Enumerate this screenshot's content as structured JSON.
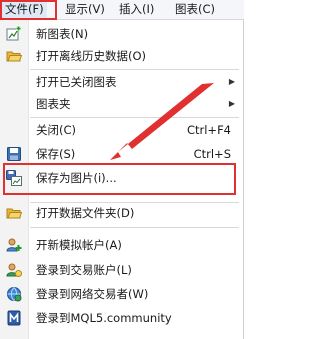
{
  "menubar": {
    "items": [
      {
        "label": "文件(F)"
      },
      {
        "label": "显示(V)"
      },
      {
        "label": "插入(I)"
      },
      {
        "label": "图表(C)"
      }
    ]
  },
  "menu": {
    "items": [
      {
        "label": "新图表(N)",
        "shortcut": "",
        "icon": "new-chart-icon"
      },
      {
        "label": "打开离线历史数据(O)",
        "shortcut": "",
        "icon": "open-folder-icon"
      },
      {
        "label": "打开已关闭图表",
        "shortcut": "",
        "icon": "",
        "submenu": true
      },
      {
        "label": "图表夹",
        "shortcut": "",
        "icon": "",
        "submenu": true
      },
      {
        "label": "关闭(C)",
        "shortcut": "Ctrl+F4",
        "icon": ""
      },
      {
        "label": "保存(S)",
        "shortcut": "Ctrl+S",
        "icon": "save-icon"
      },
      {
        "label": "保存为图片(i)...",
        "shortcut": "",
        "icon": "save-as-picture-icon"
      },
      {
        "label": "打开数据文件夹(D)",
        "shortcut": "",
        "icon": "open-folder-icon"
      },
      {
        "label": "开新模拟帐户(A)",
        "shortcut": "",
        "icon": "add-account-icon"
      },
      {
        "label": "登录到交易账户(L)",
        "shortcut": "",
        "icon": "login-icon"
      },
      {
        "label": "登录到网络交易者(W)",
        "shortcut": "",
        "icon": "web-trader-icon"
      },
      {
        "label": "登录到MQL5.community",
        "shortcut": "",
        "icon": "mql5-icon"
      }
    ]
  },
  "colors": {
    "annotation": "#e03030"
  }
}
